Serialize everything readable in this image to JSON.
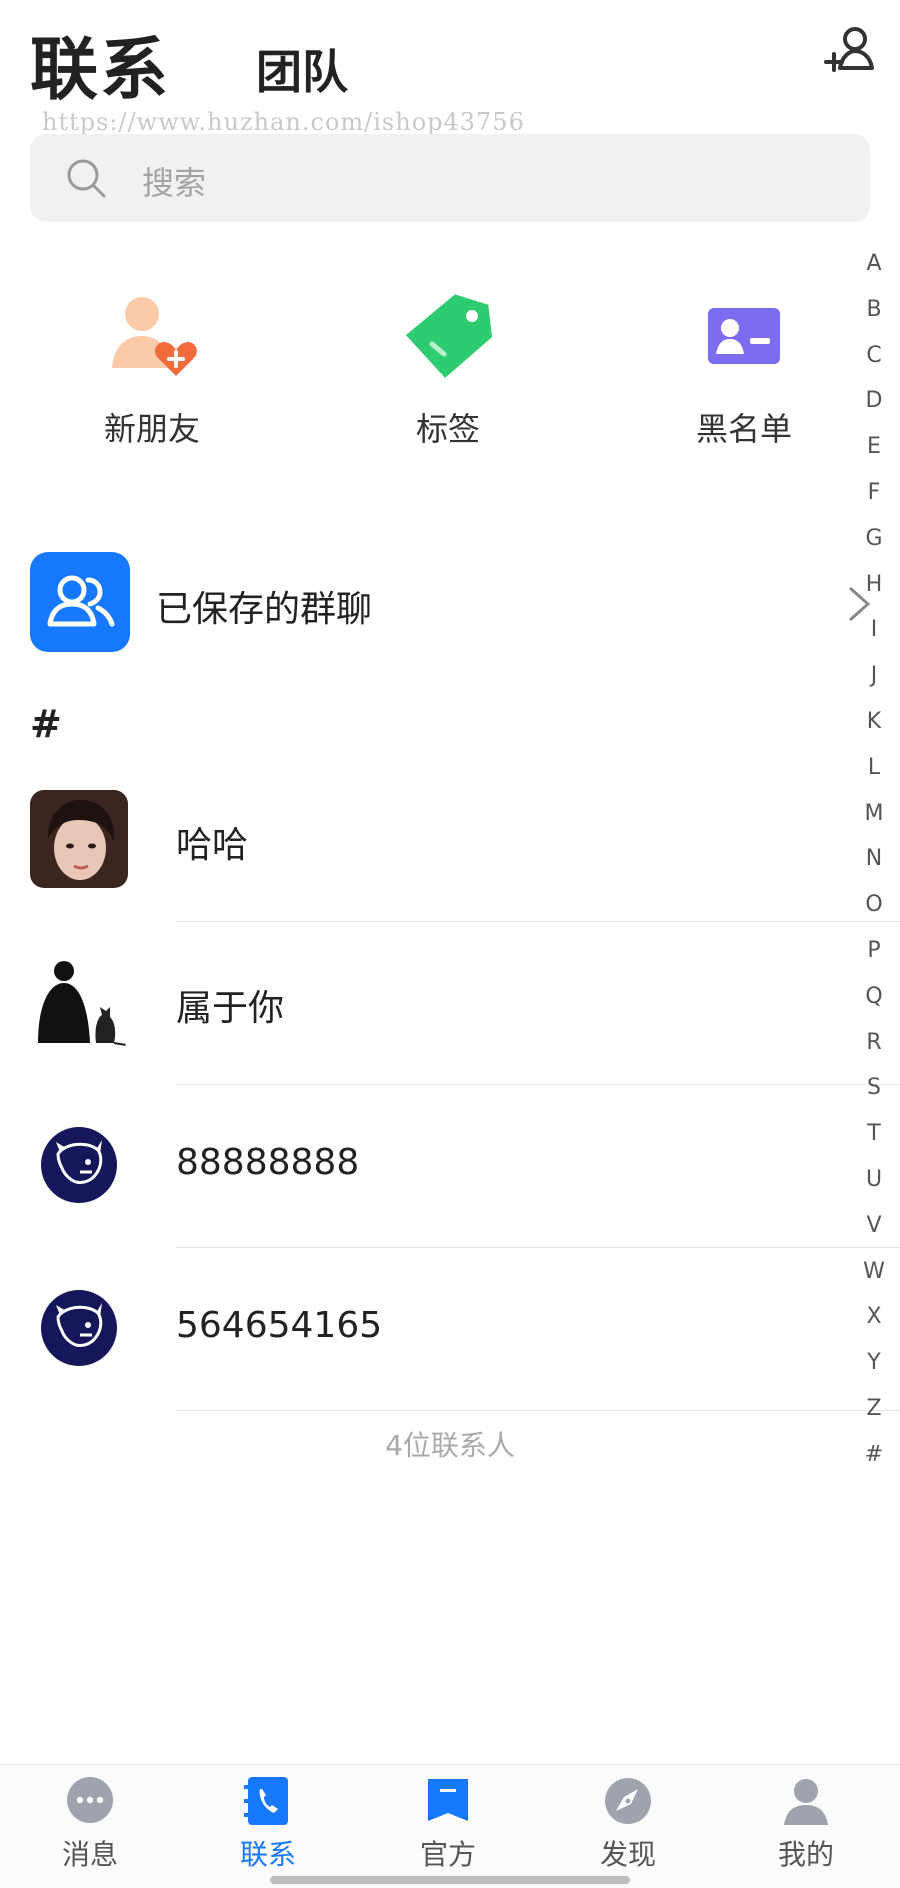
{
  "header": {
    "title": "联系",
    "tab_team": "团队",
    "watermark": "https://www.huzhan.com/ishop43756",
    "add_icon": "add-contact-icon"
  },
  "search": {
    "placeholder": "搜索",
    "icon": "search-icon"
  },
  "quick_actions": [
    {
      "label": "新朋友",
      "icon": "new-friend-icon",
      "color": "#f2904a"
    },
    {
      "label": "标签",
      "icon": "tag-icon",
      "color": "#2ecc71"
    },
    {
      "label": "黑名单",
      "icon": "blacklist-card-icon",
      "color": "#7b6cf0"
    }
  ],
  "saved_groups": {
    "label": "已保存的群聊",
    "icon": "group-chat-icon",
    "color": "#1677ff"
  },
  "section_header": "#",
  "contacts": [
    {
      "name": "哈哈",
      "avatar": "photo-avatar"
    },
    {
      "name": "属于你",
      "avatar": "silhouette-avatar"
    },
    {
      "name": "88888888",
      "avatar": "dog-logo-avatar"
    },
    {
      "name": "564654165",
      "avatar": "dog-logo-avatar"
    }
  ],
  "contact_count": "4位联系人",
  "alpha_index": [
    "A",
    "B",
    "C",
    "D",
    "E",
    "F",
    "G",
    "H",
    "I",
    "J",
    "K",
    "L",
    "M",
    "N",
    "O",
    "P",
    "Q",
    "R",
    "S",
    "T",
    "U",
    "V",
    "W",
    "X",
    "Y",
    "Z",
    "#"
  ],
  "tabbar": {
    "active_color": "#1677ff",
    "items": [
      {
        "label": "消息",
        "icon": "message-bubble-icon",
        "active": false
      },
      {
        "label": "联系",
        "icon": "contacts-phone-icon",
        "active": true
      },
      {
        "label": "官方",
        "icon": "official-bookmark-icon",
        "active": false
      },
      {
        "label": "发现",
        "icon": "compass-icon",
        "active": false
      },
      {
        "label": "我的",
        "icon": "profile-icon",
        "active": false
      }
    ]
  }
}
